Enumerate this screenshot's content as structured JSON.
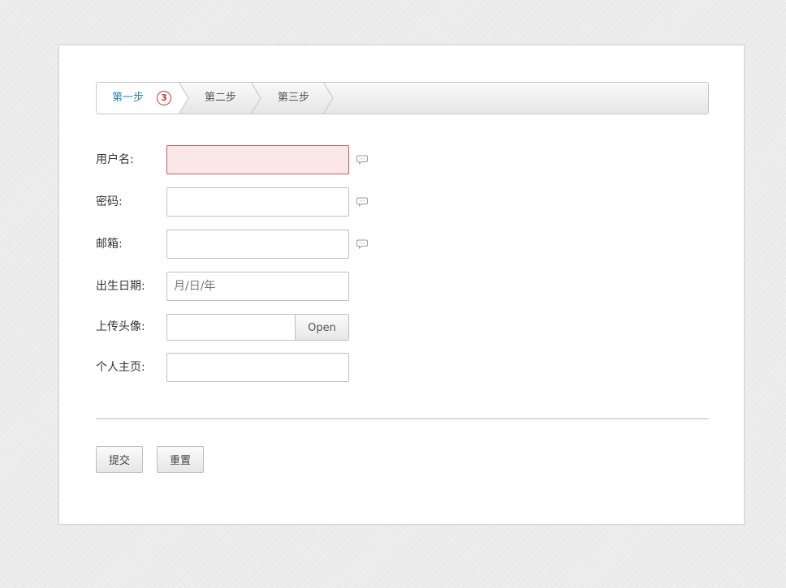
{
  "steps": {
    "items": [
      {
        "label": "第一步"
      },
      {
        "label": "第二步"
      },
      {
        "label": "第三步"
      }
    ],
    "badge": "3"
  },
  "form": {
    "username": {
      "label": "用户名:",
      "value": ""
    },
    "password": {
      "label": "密码:",
      "value": ""
    },
    "email": {
      "label": "邮箱:",
      "value": ""
    },
    "birthday": {
      "label": "出生日期:",
      "placeholder": "月/日/年"
    },
    "avatar": {
      "label": "上传头像:",
      "button_label": "Open"
    },
    "homepage": {
      "label": "个人主页:",
      "value": ""
    }
  },
  "actions": {
    "submit_label": "提交",
    "reset_label": "重置"
  },
  "colors": {
    "active_step": "#2a7fb8",
    "badge": "#c7373a",
    "error_border": "#d05d5d",
    "error_background": "#fae8e8"
  },
  "icons": {
    "hint": "speech-bubble-icon",
    "step_separator": "chevron-right-icon"
  }
}
